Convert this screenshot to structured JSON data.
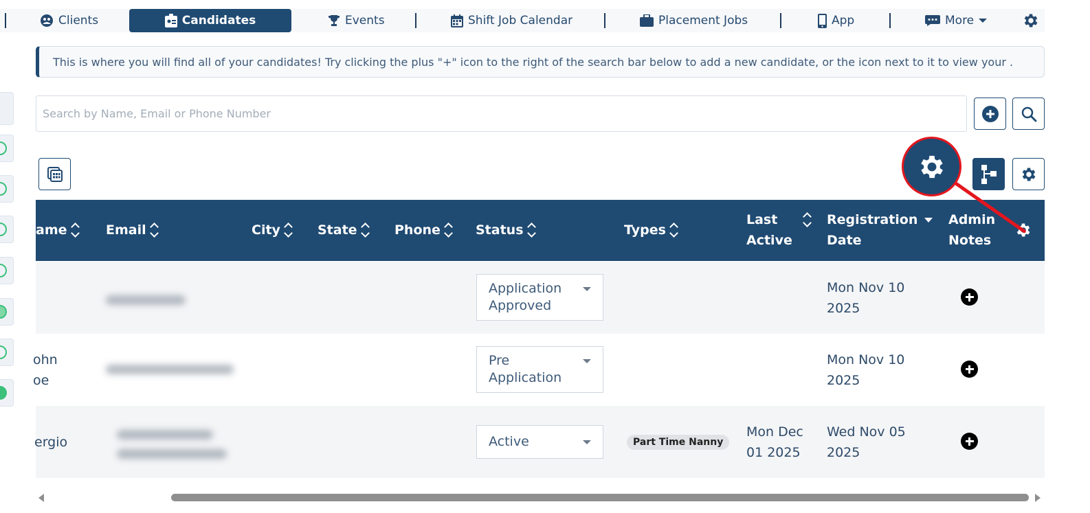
{
  "nav": {
    "items": [
      {
        "label": "Clients",
        "icon": "clients-icon"
      },
      {
        "label": "Candidates",
        "icon": "id-badge-icon",
        "active": true
      },
      {
        "label": "Events",
        "icon": "trophy-icon"
      },
      {
        "label": "Shift Job Calendar",
        "icon": "calendar-icon"
      },
      {
        "label": "Placement Jobs",
        "icon": "briefcase-icon"
      },
      {
        "label": "App",
        "icon": "mobile-icon"
      },
      {
        "label": "More",
        "icon": "comment-dots-icon"
      }
    ],
    "settings_icon": "gear-icon"
  },
  "banner": {
    "text": "This is where you will find all of your candidates! Try clicking the plus \"+\" icon to the right of the search bar below to add a new candidate, or the icon next to it to view your ."
  },
  "search": {
    "placeholder": "Search by Name, Email or Phone Number",
    "value": ""
  },
  "table": {
    "columns": [
      "ame",
      "Email",
      "City",
      "State",
      "Phone",
      "Status",
      "Types",
      "Last Active",
      "Registration Date",
      "Admin Notes"
    ],
    "last_active_l1": "Last",
    "last_active_l2": "Active",
    "reg_l1": "Registration",
    "reg_l2": "Date",
    "admin_l1": "Admin",
    "admin_l2": "Notes",
    "rows": [
      {
        "name_l1": "",
        "name_l2": "",
        "status_l1": "Application",
        "status_l2": "Approved",
        "type": "",
        "last_l1": "",
        "last_l2": "",
        "reg_l1": "Mon Nov 10",
        "reg_l2": "2025"
      },
      {
        "name_l1": "ohn",
        "name_l2": "oe",
        "status_l1": "Pre",
        "status_l2": "Application",
        "type": "",
        "last_l1": "",
        "last_l2": "",
        "reg_l1": "Mon Nov 10",
        "reg_l2": "2025"
      },
      {
        "name_l1": "ergio",
        "name_l2": "",
        "status_l1": "Active",
        "status_l2": "",
        "type": "Part Time Nanny",
        "last_l1": "Mon Dec",
        "last_l2": "01 2025",
        "reg_l1": "Wed Nov 05",
        "reg_l2": "2025"
      }
    ]
  },
  "colors": {
    "brand": "#1f4a72",
    "highlight": "#e4161e",
    "status_green": "#3cc07a"
  }
}
